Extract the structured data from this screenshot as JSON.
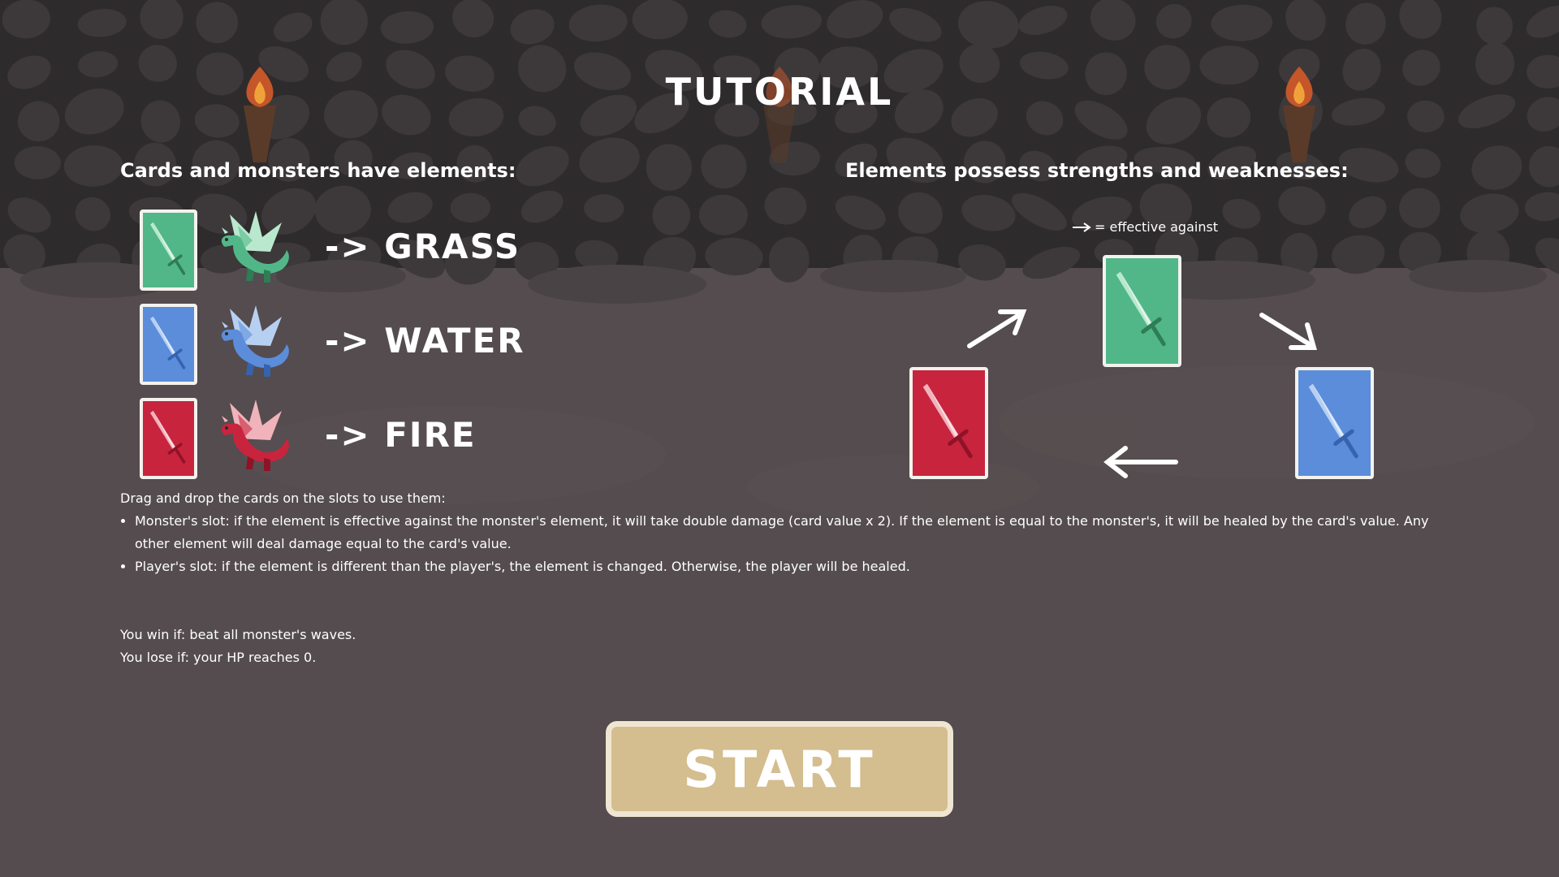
{
  "title": "TUTORIAL",
  "elements_heading": "Cards and monsters have elements:",
  "strengths_heading": "Elements possess strengths and weaknesses:",
  "elements": [
    {
      "name": "GRASS",
      "label": "-> GRASS",
      "color": "#52b788",
      "light": "#b9e8cf",
      "dark": "#2e7d55"
    },
    {
      "name": "WATER",
      "label": "-> WATER",
      "color": "#5b8ddb",
      "light": "#b7d0f2",
      "dark": "#3663ad"
    },
    {
      "name": "FIRE",
      "label": "-> FIRE",
      "color": "#c8243e",
      "light": "#f0b3bb",
      "dark": "#8f1327"
    }
  ],
  "legend": {
    "arrow_icon": "right-arrow-icon",
    "text": "= effective against"
  },
  "rules": {
    "intro": "Drag and drop the cards on the slots to use them:",
    "bullets": [
      "Monster's slot: if the element is effective against the monster's element, it will take double damage (card value x 2). If the element is equal to the monster's, it will be healed by the card's value. Any other element will deal damage equal to the card's value.",
      "Player's slot: if the element is different than the player's, the element is changed. Otherwise, the player will be healed."
    ]
  },
  "win": "You win if: beat all monster's waves.",
  "lose": "You lose if: your HP reaches 0.",
  "start_label": "START",
  "colors": {
    "background_top": "#2e2b2c",
    "background_floor": "#544c4e",
    "button": "#d4bd8e",
    "button_border": "#efe6d2",
    "card_border": "#f3f2ee"
  }
}
